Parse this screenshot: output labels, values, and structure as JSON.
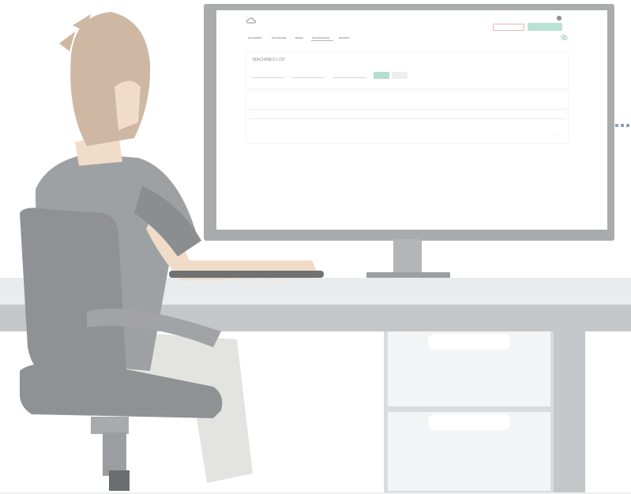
{
  "header": {
    "brand": "",
    "user_name": "",
    "user_role": "",
    "secondary_button": "",
    "primary_button": ""
  },
  "nav": {
    "machines": "MACHINES",
    "software": "SOFTWARE",
    "media": "MEDIA",
    "datasource": "DATASOURCE",
    "report": "REPORT"
  },
  "machines_list": {
    "title": "MACHINES LIST",
    "location_placeholder": "",
    "region_placeholder": "",
    "search_placeholder": "",
    "search_button": "",
    "reset_button": ""
  },
  "table": {
    "columns": [
      "",
      "",
      "",
      "",
      ""
    ],
    "rows": [
      [
        "",
        "",
        "",
        "",
        ""
      ],
      [
        "",
        "",
        "",
        "",
        ""
      ]
    ]
  },
  "pager": {
    "rows_per_page_label": "",
    "rows_per_page_value": "",
    "range": ""
  },
  "icons": {
    "brand": "cloud-icon",
    "settings": "gear-icon",
    "help": "chat-bubbles-icon",
    "prev": "chevron-left-icon",
    "next": "chevron-right-icon"
  },
  "colors": {
    "accent_green": "#b9e2d3",
    "accent_red": "#e7a7a7",
    "monitor_frame": "#a9abac",
    "desk": "#e9ebec",
    "desk_legs": "#c4c7c9",
    "shirt": "#9ea1a4",
    "chair": "#8f9194",
    "skin": "#f1dcc9",
    "hair": "#cfb8a3",
    "pants": "#e3e3e0",
    "cable_dots": "#8ea0bd"
  }
}
